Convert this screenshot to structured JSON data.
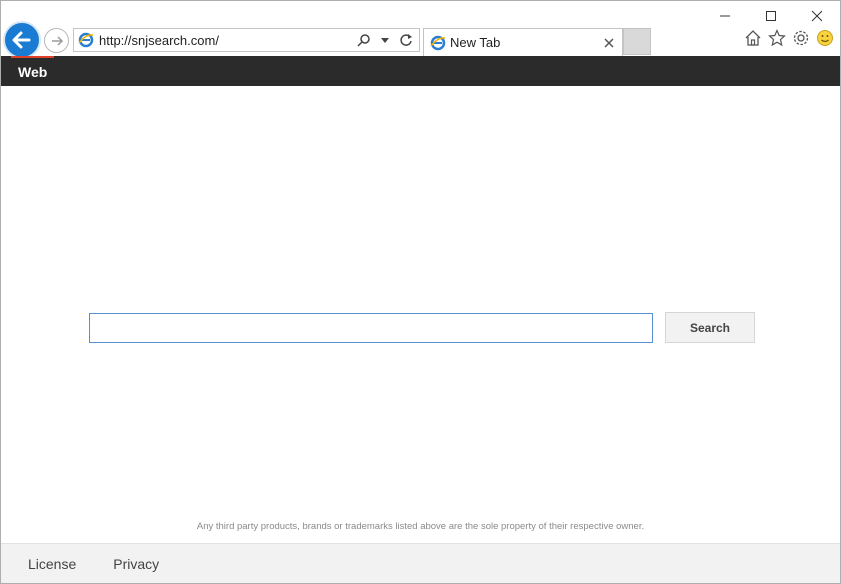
{
  "browser": {
    "address_url": "http://snjsearch.com/",
    "tab_title": "New Tab",
    "icons": {
      "back": "back-arrow-icon",
      "forward": "forward-arrow-icon",
      "search": "search-icon",
      "dropdown": "chevron-down-icon",
      "refresh": "refresh-icon",
      "home": "home-icon",
      "favorites": "star-icon",
      "settings": "gear-icon",
      "feedback": "smiley-icon"
    },
    "colors": {
      "back_button": "#1a7bd2",
      "site_bar": "#2b2b2b",
      "web_tab_accent": "#e0402a"
    }
  },
  "site": {
    "nav_web_label": "Web",
    "search": {
      "placeholder": "",
      "value": "",
      "button_label": "Search"
    },
    "disclaimer": "Any third party products, brands or trademarks listed above are the sole property of their respective owner.",
    "footer": {
      "license_label": "License",
      "privacy_label": "Privacy"
    }
  }
}
